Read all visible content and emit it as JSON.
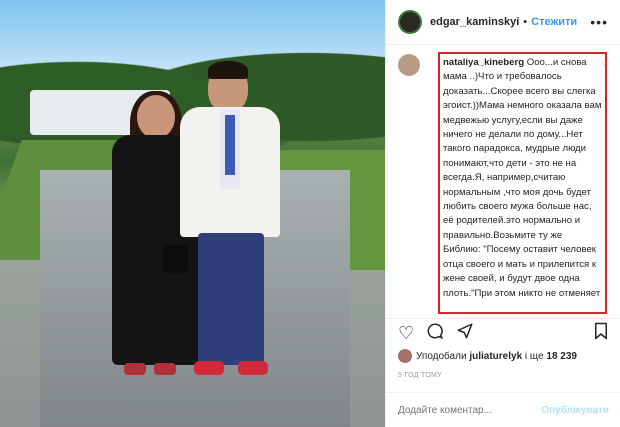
{
  "photo": {
    "alt_subject": "photo"
  },
  "header": {
    "username": "edgar_kaminskyi",
    "separator": "•",
    "follow_label": "Стежити",
    "more_icon": "more-dots-icon"
  },
  "comment": {
    "username": "nataliya_kineberg",
    "text": "Ооо...и снова мама ..)Что и требовалось доказать...Скорее всего вы слегка эгоист.))Мама немного оказала вам медвежью услугу,если вы даже ничего не делали по дому...Нет такого парадокса, мудрые люди понимают,что дети - это не на всегда.Я, например,считаю нормальным ,что моя дочь будет любить своего мужа больше нас, её родителей.это нормально и правильно.Возьмите ту же Библию: \"Посему оставит человек отца своего и мать и прилепится к жене своей, и будут двое одна плоть.\"При этом никто не отменяет",
    "highlight_color": "#d72626"
  },
  "actions": {
    "like_icon": "heart-icon",
    "comment_icon": "comment-icon",
    "share_icon": "share-icon",
    "save_icon": "bookmark-icon"
  },
  "likes": {
    "prefix": "Уподобали",
    "user": "juliaturelyk",
    "conj": "і ще",
    "count": "18 239"
  },
  "timestamp": "5 ГОД ТОМУ",
  "add_comment": {
    "placeholder": "Додайте коментар...",
    "publish_label": "Опублікувати"
  },
  "colors": {
    "link": "#3897f0",
    "publish_disabled": "#b2dffc"
  }
}
